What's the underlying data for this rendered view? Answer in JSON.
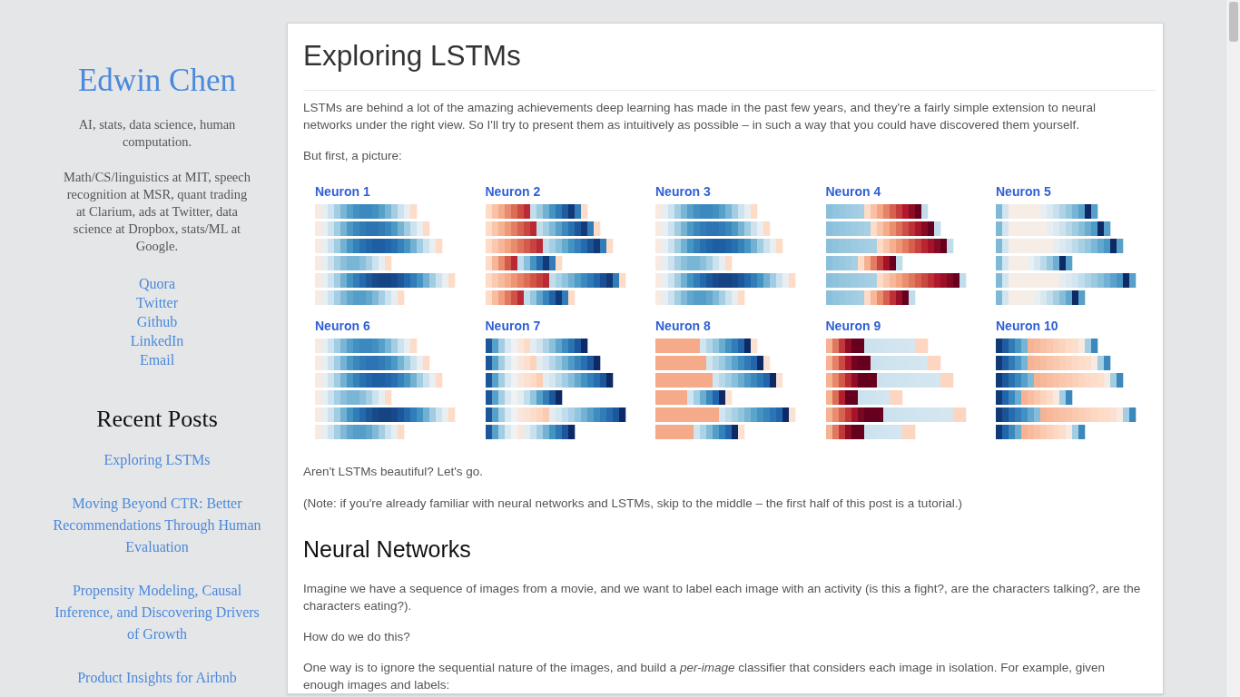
{
  "sidebar": {
    "site_title": "Edwin Chen",
    "tagline": "AI, stats, data science, human computation.",
    "bio": "Math/CS/linguistics at MIT, speech recognition at MSR, quant trading at Clarium, ads at Twitter, data science at Dropbox, stats/ML at Google.",
    "links": [
      "Quora",
      "Twitter",
      "Github",
      "LinkedIn",
      "Email"
    ],
    "recent_posts": {
      "heading": "Recent Posts",
      "items": [
        "Exploring LSTMs",
        "Moving Beyond CTR: Better Recommendations Through Human Evaluation",
        "Propensity Modeling, Causal Inference, and Discovering Drivers of Growth",
        "Product Insights for Airbnb"
      ]
    }
  },
  "article": {
    "title": "Exploring LSTMs",
    "intro": [
      "LSTMs are behind a lot of the amazing achievements deep learning has made in the past few years, and they're a fairly simple extension to neural networks under the right view. So I'll try to present them as intuitively as possible – in such a way that you could have discovered them yourself.",
      "But first, a picture:"
    ],
    "figure": {
      "neurons": [
        "Neuron 1",
        "Neuron 2",
        "Neuron 3",
        "Neuron 4",
        "Neuron 5",
        "Neuron 6",
        "Neuron 7",
        "Neuron 8",
        "Neuron 9",
        "Neuron 10"
      ]
    },
    "after_figure": [
      "Aren't LSTMs beautiful? Let's go.",
      "(Note: if you're already familiar with neural networks and LSTMs, skip to the middle – the first half of this post is a tutorial.)"
    ],
    "sections": [
      {
        "heading": "Neural Networks",
        "paragraphs": [
          "Imagine we have a sequence of images from a movie, and we want to label each image with an activity (is this a fight?, are the characters talking?, are the characters eating?).",
          "How do we do this?",
          "One way is to ignore the sequential nature of the images, and build a *per-image* classifier that considers each image in isolation. For example, given enough images and labels:"
        ]
      }
    ]
  }
}
